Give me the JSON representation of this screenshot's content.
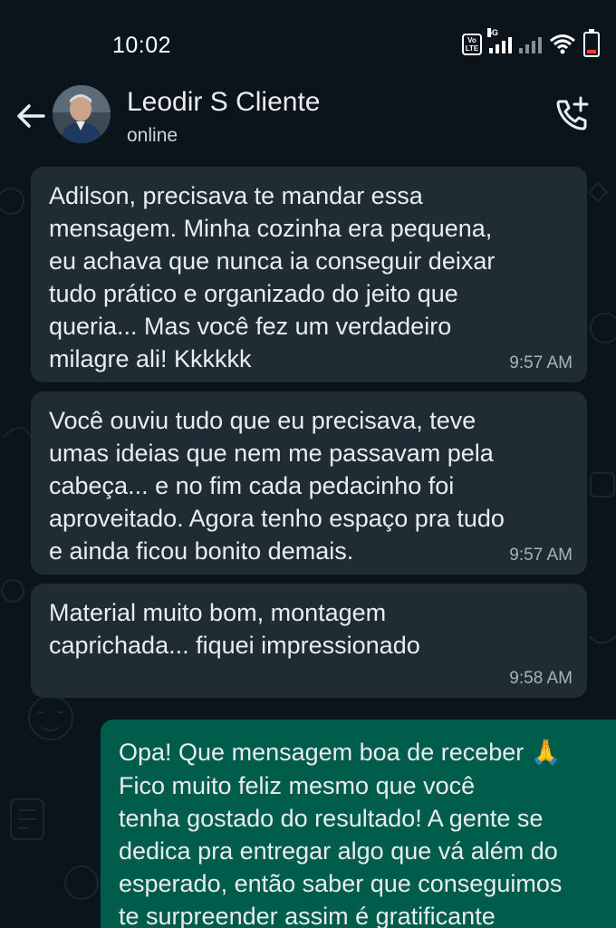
{
  "status_bar": {
    "time": "10:02",
    "volte_label": "Vo LTE",
    "network_label": "5G"
  },
  "header": {
    "contact_name": "Leodir S Cliente",
    "contact_status": "online",
    "back_icon": "arrow-left-icon",
    "call_icon": "add-call-icon"
  },
  "messages": [
    {
      "direction": "incoming",
      "text": "Adilson, precisava te mandar essa\nmensagem. Minha cozinha era pequena,\neu achava que nunca ia conseguir deixar\ntudo prático e organizado do jeito que\nqueria... Mas você fez um verdadeiro\nmilagre ali! Kkkkkk",
      "time": "9:57 AM"
    },
    {
      "direction": "incoming",
      "text": "Você ouviu tudo que eu precisava, teve\numas ideias que nem me passavam pela\ncabeça... e no fim cada pedacinho foi\naproveitado. Agora tenho espaço pra tudo\ne ainda ficou bonito demais.",
      "time": "9:57 AM"
    },
    {
      "direction": "incoming",
      "text": "Material muito bom, montagem\ncaprichada... fiquei impressionado",
      "time": "9:58 AM"
    },
    {
      "direction": "outgoing",
      "text": "Opa! Que mensagem boa de receber",
      "emoji": "🙏",
      "text_continued": "Fico muito feliz mesmo que você\ntenha gostado do resultado! A gente se\ndedica pra entregar algo que vá além do\nesperado, então saber que conseguimos\nte surpreender assim é gratificante"
    }
  ],
  "colors": {
    "background": "#0b141a",
    "incoming_bubble": "#202c33",
    "outgoing_bubble": "#005c4b",
    "text": "#e9edef",
    "timestamp": "#a8b2b8"
  }
}
